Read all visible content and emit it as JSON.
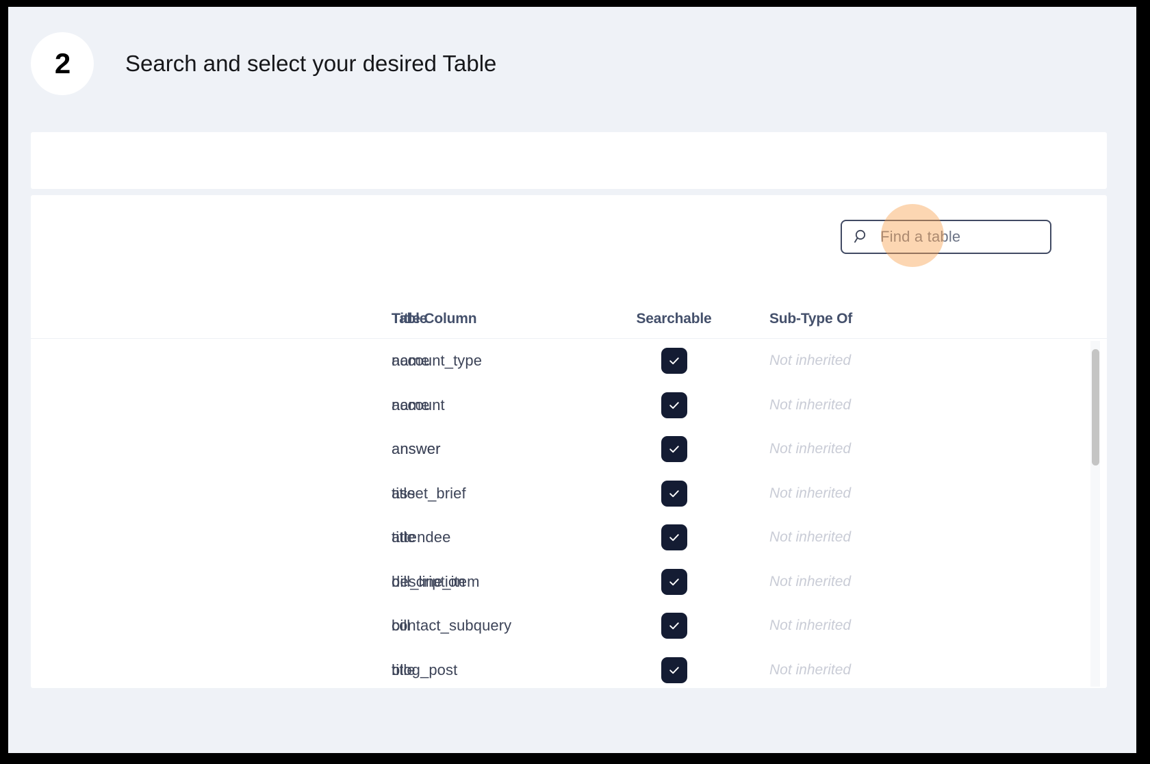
{
  "step": {
    "number": "2",
    "title": "Search and select your desired Table"
  },
  "search": {
    "placeholder": "Find a table",
    "icon": "search-icon"
  },
  "table": {
    "columns": [
      "Table",
      "Title Column",
      "Searchable",
      "Sub-Type Of"
    ],
    "rows": [
      {
        "table": "account_type",
        "title_column": "name",
        "searchable": true,
        "sub_type_of": "Not inherited"
      },
      {
        "table": "account",
        "title_column": "name",
        "searchable": true,
        "sub_type_of": "Not inherited"
      },
      {
        "table": "answer",
        "title_column": "answer",
        "searchable": true,
        "sub_type_of": "Not inherited"
      },
      {
        "table": "asset_brief",
        "title_column": "title",
        "searchable": true,
        "sub_type_of": "Not inherited"
      },
      {
        "table": "attendee",
        "title_column": "title",
        "searchable": true,
        "sub_type_of": "Not inherited"
      },
      {
        "table": "bill_line_item",
        "title_column": "description",
        "searchable": true,
        "sub_type_of": "Not inherited"
      },
      {
        "table": "bill",
        "title_column": "contact_subquery",
        "searchable": true,
        "sub_type_of": "Not inherited"
      },
      {
        "table": "blog_post",
        "title_column": "title",
        "searchable": true,
        "sub_type_of": "Not inherited"
      }
    ]
  },
  "colors": {
    "page_background": "#eff2f7",
    "panel": "#ffffff",
    "checkbox": "#141c33",
    "header_text": "#44506b",
    "muted_text": "#c9ccd6",
    "search_border": "#414a63",
    "highlight": "#f8a454"
  }
}
